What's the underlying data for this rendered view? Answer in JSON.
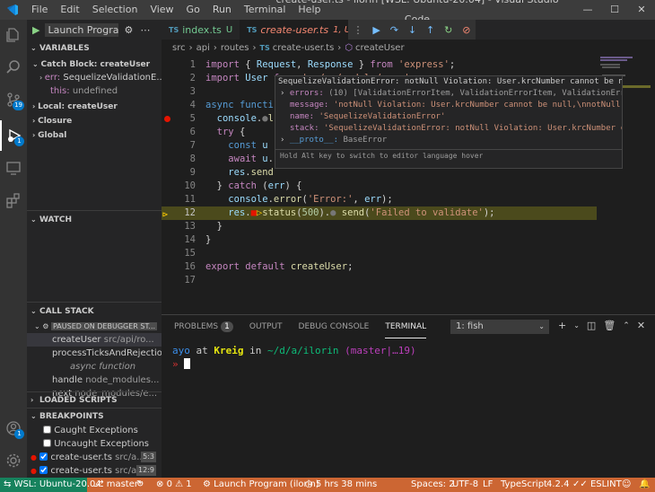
{
  "window": {
    "title": "create-user.ts - ilorin [WSL: Ubuntu-20.04] - Visual Studio Code",
    "menu": [
      "File",
      "Edit",
      "Selection",
      "View",
      "Go",
      "Run",
      "Terminal",
      "Help"
    ],
    "controls": [
      "—",
      "☐",
      "✕"
    ]
  },
  "activity_bar": {
    "scm_badge": "19",
    "debug_badge": "1",
    "account_badge": "1"
  },
  "sidebar": {
    "launch_config": "Launch Program",
    "variables_title": "VARIABLES",
    "variables": [
      {
        "label": "Catch Block: createUser"
      },
      {
        "name": "err:",
        "value": "SequelizeValidationE..."
      },
      {
        "name": "this:",
        "value": "undefined"
      },
      {
        "label": "Local: createUser"
      },
      {
        "label": "Closure"
      },
      {
        "label": "Global"
      }
    ],
    "watch_title": "WATCH",
    "callstack_title": "CALL STACK",
    "callstack_paused": "PAUSED ON DEBUGGER ST...",
    "callstack": [
      {
        "fn": "createUser",
        "src": "src/api/ro..."
      },
      {
        "fn": "processTicksAndRejections",
        "src": ""
      },
      {
        "fn": "async function",
        "src": ""
      },
      {
        "fn": "handle",
        "src": "node_modules..."
      },
      {
        "fn": "next",
        "src": "node_modules/e..."
      }
    ],
    "loaded_scripts_title": "LOADED SCRIPTS",
    "breakpoints_title": "BREAKPOINTS",
    "breakpoints": [
      {
        "label": "Caught Exceptions",
        "file": "",
        "line": ""
      },
      {
        "label": "Uncaught Exceptions",
        "file": "",
        "line": ""
      },
      {
        "label": "create-user.ts",
        "file": "src/a...",
        "line": "5:3"
      },
      {
        "label": "create-user.ts",
        "file": "src/a...",
        "line": "12:9"
      }
    ]
  },
  "tabs": [
    {
      "label": "index.ts",
      "status": "U"
    },
    {
      "label": "create-user.ts",
      "status": "1, U"
    }
  ],
  "breadcrumb": [
    "src",
    "api",
    "routes",
    "create-user.ts",
    "createUser"
  ],
  "code_lines": [
    {
      "n": "1",
      "html": "<span class='kw2'>import</span> { <span class='var'>Request</span>, <span class='var'>Response</span> } <span class='kw2'>from</span> <span class='str'>'express'</span>;"
    },
    {
      "n": "2",
      "html": "<span class='kw2'>import</span> <span class='var'>User</span> <span class='kw2'>from</span> <span class='str'>'../../models/user'</span>;"
    },
    {
      "n": "3",
      "html": ""
    },
    {
      "n": "4",
      "html": "<span class='kw'>async</span> <span class='kw'>functi</span>"
    },
    {
      "n": "5",
      "html": "  <span class='var'>console</span>.<span style='color:#777'>●</span><span class='fn'>l</span>"
    },
    {
      "n": "6",
      "html": "  <span class='kw2'>try</span> {"
    },
    {
      "n": "7",
      "html": "    <span class='kw'>const</span> <span class='var'>u</span>"
    },
    {
      "n": "8",
      "html": "    <span class='kw2'>await</span> <span class='var'>u</span>."
    },
    {
      "n": "9",
      "html": "    <span class='var'>res</span>.<span class='fn'>send</span>"
    },
    {
      "n": "10",
      "html": "  } <span class='kw2'>catch</span> (<span class='var'>err</span>) {"
    },
    {
      "n": "11",
      "html": "    <span class='var'>console</span>.<span class='fn'>error</span>(<span class='str'>'Error:'</span>, <span class='var'>err</span>);"
    },
    {
      "n": "12",
      "html": "    <span class='var'>res</span>.<span style='color:#e51400'>■</span><span style='color:#ffcc00'>▷</span><span class='fn'>status</span>(<span class='num'>500</span>).<span style='color:#777'>●</span> <span class='fn'>send</span>(<span class='str'>'Failed to validate'</span>);"
    },
    {
      "n": "13",
      "html": "  }"
    },
    {
      "n": "14",
      "html": "}"
    },
    {
      "n": "15",
      "html": ""
    },
    {
      "n": "16",
      "html": "<span class='kw2'>export</span> <span class='kw2'>default</span> <span class='fn'>createUser</span>;"
    },
    {
      "n": "17",
      "html": ""
    }
  ],
  "hover": {
    "header": "SequelizeValidationError: notNull Violation: User.krcNumber cannot be null,\\nnotN...",
    "rows": [
      {
        "k": "errors:",
        "v": "(10) [ValidationErrorItem, ValidationErrorItem, ValidationErrorIt...",
        "exp": true
      },
      {
        "k": "message:",
        "v": "'notNull Violation: User.krcNumber cannot be null,\\nnotNull Vi...",
        "exp": false
      },
      {
        "k": "name:",
        "v": "'SequelizeValidationError'",
        "exp": false
      },
      {
        "k": "stack:",
        "v": "'SequelizeValidationError: notNull Violation: User.krcNumber canno...",
        "exp": false
      },
      {
        "k": "__proto__:",
        "v": "BaseError",
        "exp": true
      }
    ],
    "hint": "Hold Alt key to switch to editor language hover"
  },
  "panel": {
    "tabs": [
      "PROBLEMS",
      "OUTPUT",
      "DEBUG CONSOLE",
      "TERMINAL"
    ],
    "problems_count": "1",
    "terminal_select": "1: fish",
    "prompt_user": "ayo",
    "prompt_at": "at",
    "prompt_host": "Kreig",
    "prompt_in": "in",
    "prompt_path": "~/d/a/ilorin",
    "prompt_branch": "(master|…19)",
    "prompt_arrow": "»"
  },
  "statusbar": {
    "remote": "WSL: Ubuntu-20.04",
    "branch": "master*",
    "errors": "0",
    "warnings": "1",
    "launch": "Launch Program (ilorin)",
    "time": "5 hrs 38 mins",
    "spaces": "Spaces: 2",
    "encoding": "UTF-8",
    "eol": "LF",
    "language": "TypeScript",
    "version": "4.2.4",
    "eslint": "ESLINT"
  },
  "colors": {
    "statusbar": "#cc6633",
    "remote": "#16825d",
    "accent": "#007acc",
    "breakpoint": "#e51400",
    "current_line": "#4b4a1c"
  }
}
